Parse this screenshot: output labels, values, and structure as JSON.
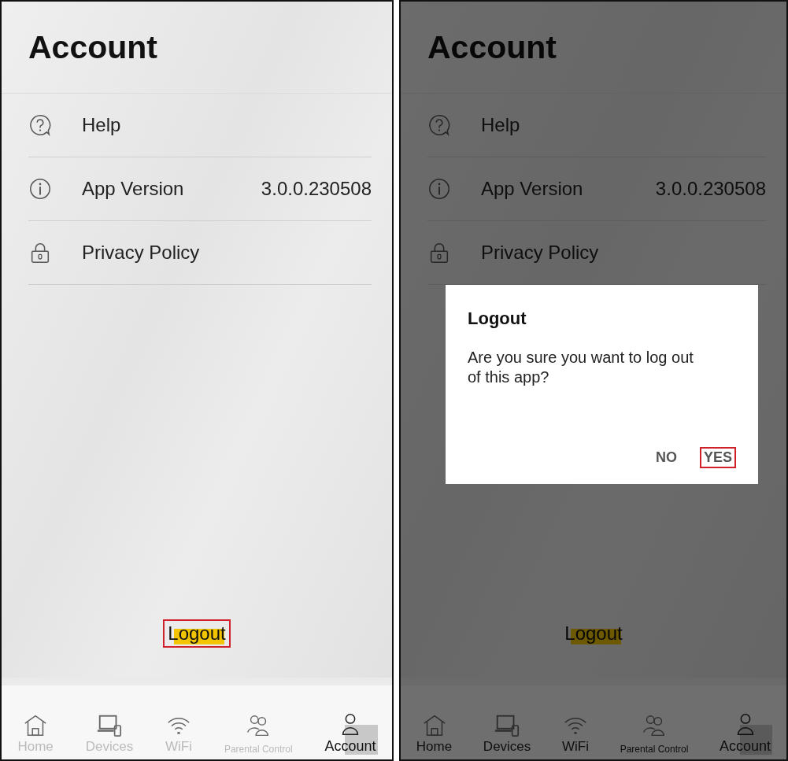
{
  "screens": [
    {
      "title": "Account",
      "items": [
        {
          "kind": "help",
          "label": "Help"
        },
        {
          "kind": "info",
          "label": "App Version",
          "value": "3.0.0.230508"
        },
        {
          "kind": "lock",
          "label": "Privacy Policy"
        }
      ],
      "logout": {
        "label": "Logout",
        "highlighted": true
      },
      "nav": [
        {
          "label": "Home",
          "selected": false
        },
        {
          "label": "Devices",
          "selected": false
        },
        {
          "label": "WiFi",
          "selected": false
        },
        {
          "label": "Parental Control",
          "selected": false
        },
        {
          "label": "Account",
          "selected": true
        }
      ]
    },
    {
      "title": "Account",
      "items": [
        {
          "kind": "help",
          "label": "Help"
        },
        {
          "kind": "info",
          "label": "App Version",
          "value": "3.0.0.230508"
        },
        {
          "kind": "lock",
          "label": "Privacy Policy"
        }
      ],
      "logout": {
        "label": "Logout",
        "highlighted": false
      },
      "nav": [
        {
          "label": "Home",
          "selected": false
        },
        {
          "label": "Devices",
          "selected": false
        },
        {
          "label": "WiFi",
          "selected": false
        },
        {
          "label": "Parental Control",
          "selected": false
        },
        {
          "label": "Account",
          "selected": true
        }
      ],
      "dialog": {
        "title": "Logout",
        "message": "Are you sure you want to log out of this app?",
        "buttons": [
          {
            "label": "NO",
            "highlighted": false
          },
          {
            "label": "YES",
            "highlighted": true
          }
        ]
      }
    }
  ]
}
